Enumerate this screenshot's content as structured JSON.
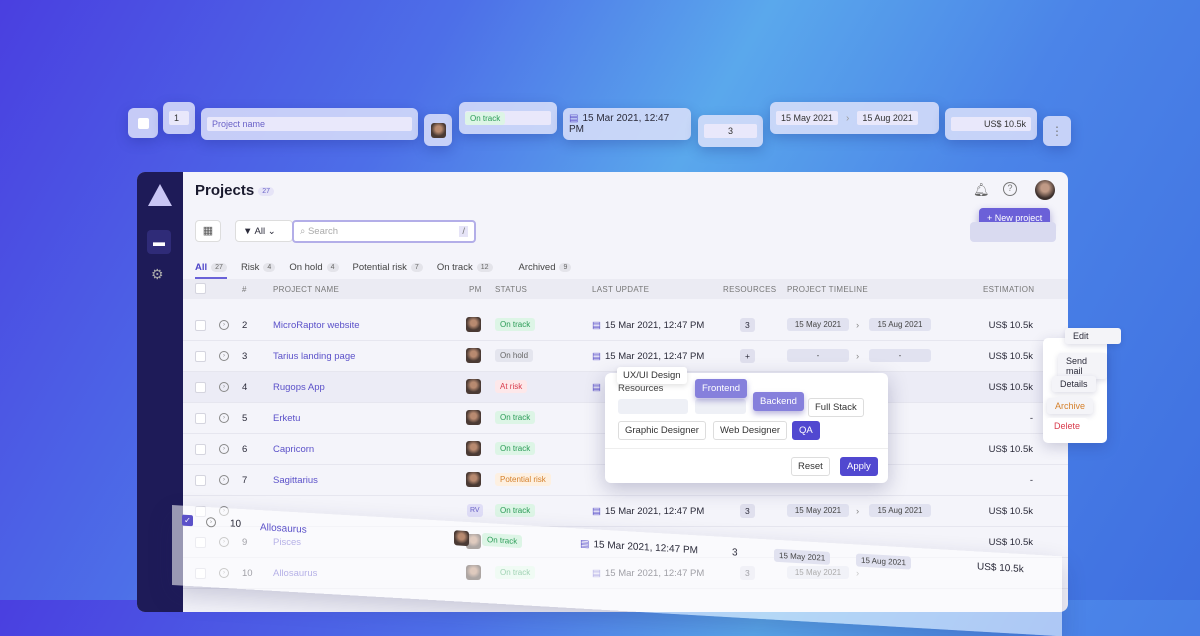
{
  "floating_toolbar": {
    "index": "1",
    "name_placeholder": "Project name",
    "status": "On track",
    "last_update": "15 Mar 2021, 12:47 PM",
    "resources": "3",
    "timeline_start": "15 May 2021",
    "timeline_end": "15 Aug 2021",
    "estimation": "US$ 10.5k"
  },
  "header": {
    "title": "Projects",
    "count": "27",
    "new_project": "+ New project"
  },
  "toolbar": {
    "filter_label": "All",
    "search_placeholder": "Search",
    "search_shortcut": "/"
  },
  "tabs": [
    {
      "label": "All",
      "count": "27"
    },
    {
      "label": "Risk",
      "count": "4"
    },
    {
      "label": "On hold",
      "count": "4"
    },
    {
      "label": "Potential risk",
      "count": "7"
    },
    {
      "label": "On track",
      "count": "12"
    },
    {
      "label": "Archived",
      "count": "9"
    }
  ],
  "columns": {
    "num": "#",
    "name": "PROJECT NAME",
    "pm": "PM",
    "status": "STATUS",
    "last_update": "LAST UPDATE",
    "resources": "RESOURCES",
    "timeline": "PROJECT TIMELINE",
    "estimation": "ESTIMATION"
  },
  "rows": [
    {
      "num": "2",
      "name": "MicroRaptor website",
      "status": "On track",
      "cls": "ontrack",
      "date": "15 Mar 2021, 12:47 PM",
      "res": "3",
      "start": "15 May 2021",
      "end": "15 Aug 2021",
      "est": "US$ 10.5k"
    },
    {
      "num": "3",
      "name": "Tarius landing page",
      "status": "On hold",
      "cls": "onhold",
      "date": "15 Mar 2021, 12:47 PM",
      "res": "+",
      "start": "-",
      "end": "-",
      "est": "US$ 10.5k"
    },
    {
      "num": "4",
      "name": "Rugops App",
      "status": "At risk",
      "cls": "atrisk",
      "date": "15 Mar 2021, 12:47 PM",
      "res": "",
      "start": "",
      "end": "",
      "est": "US$ 10.5k"
    },
    {
      "num": "5",
      "name": "Erketu",
      "status": "On track",
      "cls": "ontrack",
      "date": "",
      "res": "",
      "start": "",
      "end": "",
      "est": "-"
    },
    {
      "num": "6",
      "name": "Capricorn",
      "status": "On track",
      "cls": "ontrack",
      "date": "",
      "res": "",
      "start": "",
      "end": "",
      "est": "US$ 10.5k"
    },
    {
      "num": "7",
      "name": "Sagittarius",
      "status": "Potential risk",
      "cls": "potential",
      "date": "",
      "res": "",
      "start": "",
      "end": "",
      "est": "-"
    },
    {
      "num": "",
      "name": "",
      "status": "On track",
      "cls": "ontrack",
      "date": "15 Mar 2021, 12:47 PM",
      "res": "3",
      "start": "15 May 2021",
      "end": "15 Aug 2021",
      "est": "US$ 10.5k",
      "pm": "RV"
    },
    {
      "num": "9",
      "name": "Pisces",
      "status": "",
      "cls": "",
      "date": "",
      "res": "",
      "start": "",
      "end": "",
      "est": "US$ 10.5k"
    },
    {
      "num": "10",
      "name": "Allosaurus",
      "status": "On track",
      "cls": "ontrack",
      "date": "15 Mar 2021, 12:47 PM",
      "res": "3",
      "start": "15 May 2021",
      "end": "",
      "est": ""
    }
  ],
  "popover": {
    "tooltip": "UX/UI Design",
    "label": "Resources",
    "tags": [
      "Frontend",
      "Backend",
      "Full Stack",
      "Graphic Designer",
      "Web Designer",
      "QA"
    ],
    "reset": "Reset",
    "apply": "Apply"
  },
  "row_menu": [
    "Edit",
    "Send mail",
    "Details",
    "Archive",
    "Delete"
  ],
  "dragged_row": {
    "num": "10",
    "name": "Allosaurus",
    "status": "On track",
    "date": "15 Mar 2021, 12:47 PM",
    "res": "3",
    "start": "15 May 2021",
    "end": "15 Aug 2021",
    "est": "US$ 10.5k"
  },
  "colors": {
    "accent": "#5b51c9",
    "sidebar": "#1e1b58",
    "danger": "#d83b4c",
    "warning": "#d5802b"
  }
}
